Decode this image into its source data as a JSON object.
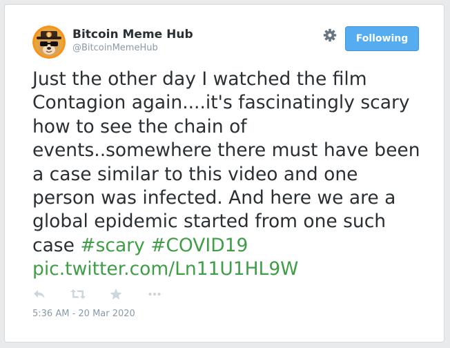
{
  "tweet": {
    "display_name": "Bitcoin Meme Hub",
    "handle": "@BitcoinMemeHub",
    "text_plain": "Just the other day I watched the film Contagion again....it's fascinatingly scary how to see the chain of events..somewhere there must have been a case similar to this video and one person was infected. And here we are a global epidemic started from one such case",
    "hashtag_1": "#scary",
    "hashtag_2": "#COVID19",
    "media_link": "pic.twitter.com/Ln11U1HL9W",
    "timestamp": "5:36 AM - 20 Mar 2020"
  },
  "follow_button": {
    "label": "Following"
  },
  "icons": {
    "settings": "gear-icon",
    "reply": "reply-icon",
    "retweet": "retweet-icon",
    "favorite": "star-icon",
    "more": "more-icon",
    "avatar": "doge-avatar"
  },
  "colors": {
    "accent_link": "#3e9e45",
    "follow_button": "#55acee",
    "text": "#292f33",
    "muted": "#8899a6",
    "icon": "#66757f",
    "action_icon": "#ccd6dd"
  }
}
